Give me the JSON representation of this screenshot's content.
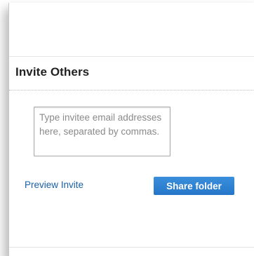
{
  "invite_section": {
    "title": "Invite Others",
    "email_field": {
      "value": "",
      "placeholder": "Type invitee email addresses here, separated by commas."
    },
    "preview_link_label": "Preview Invite",
    "share_button_label": "Share folder"
  },
  "colors": {
    "accent": "#2b80d0",
    "link": "#1a5fa8"
  }
}
